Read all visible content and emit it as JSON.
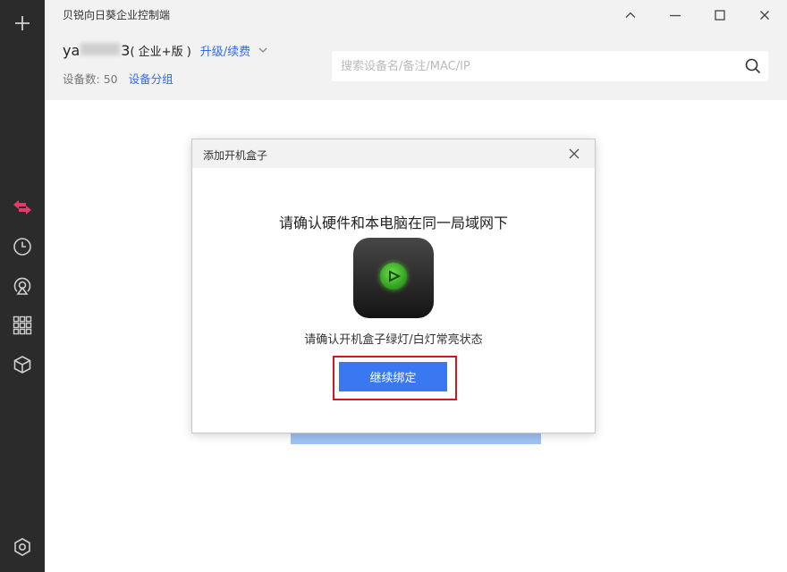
{
  "app": {
    "title": "贝锐向日葵企业控制端"
  },
  "account": {
    "name_start": "ya",
    "name_end": "3",
    "edition": "( 企业+版 )",
    "upgrade_label": "升级/续费"
  },
  "devices": {
    "count_label": "设备数:",
    "count": "50",
    "group_label": "设备分组"
  },
  "search": {
    "placeholder": "搜索设备名/备注/MAC/IP",
    "value": ""
  },
  "sidebar": {
    "items": [
      {
        "icon": "plus-icon"
      },
      {
        "icon": "remote-arrows-icon",
        "active": true
      },
      {
        "icon": "history-clock-icon"
      },
      {
        "icon": "broadcast-icon"
      },
      {
        "icon": "apps-grid-icon"
      },
      {
        "icon": "cube-icon"
      },
      {
        "icon": "settings-hex-icon"
      }
    ]
  },
  "dialog": {
    "title": "添加开机盒子",
    "heading": "请确认硬件和本电脑在同一局域网下",
    "subtext": "请确认开机盒子绿灯/白灯常亮状态",
    "button_label": "继续绑定"
  },
  "colors": {
    "accent": "#3a78f2",
    "link": "#2f6bf0",
    "sidebar_bg": "#2b2b2b",
    "active_icon": "#e8386a",
    "highlight_border": "#d0191f"
  }
}
